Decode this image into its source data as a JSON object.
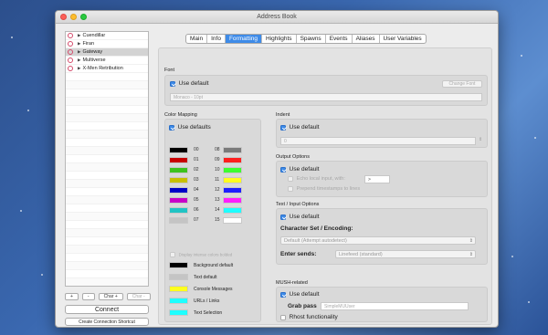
{
  "window": {
    "title": "Address Book"
  },
  "worlds": [
    {
      "name": "Cuendillar",
      "selected": false
    },
    {
      "name": "Firan",
      "selected": false
    },
    {
      "name": "Gateway",
      "selected": true
    },
    {
      "name": "Multiverse",
      "selected": false
    },
    {
      "name": "X-Men Retribution",
      "selected": false
    }
  ],
  "sidebar_buttons": {
    "add": "+",
    "remove": "-",
    "char_add": "Char +",
    "char_remove": "Char -"
  },
  "connect_label": "Connect",
  "shortcut_label": "Create Connection Shortcut",
  "tabs": [
    "Main",
    "Info",
    "Formatting",
    "Highlights",
    "Spawns",
    "Events",
    "Aliases",
    "User Variables"
  ],
  "active_tab": "Formatting",
  "font": {
    "section": "Font",
    "use_default": "Use default",
    "change_font": "Change Font",
    "value": "Monaco - 10pt"
  },
  "color_mapping": {
    "section": "Color Mapping",
    "use_defaults": "Use defaults",
    "left": [
      {
        "num": "00",
        "color": "#000000"
      },
      {
        "num": "01",
        "color": "#c80000"
      },
      {
        "num": "02",
        "color": "#3cc21e"
      },
      {
        "num": "03",
        "color": "#c8c000"
      },
      {
        "num": "04",
        "color": "#0000c8"
      },
      {
        "num": "05",
        "color": "#c800c8"
      },
      {
        "num": "06",
        "color": "#20c4c4"
      },
      {
        "num": "07",
        "color": "#c4c4c4"
      }
    ],
    "right": [
      {
        "num": "08",
        "color": "#7a7a7a"
      },
      {
        "num": "09",
        "color": "#ff1e1e"
      },
      {
        "num": "10",
        "color": "#3cff30"
      },
      {
        "num": "11",
        "color": "#ffff1e"
      },
      {
        "num": "12",
        "color": "#1e1eff"
      },
      {
        "num": "13",
        "color": "#ff1eff"
      },
      {
        "num": "14",
        "color": "#1effff"
      },
      {
        "num": "15",
        "color": "#ffffff"
      }
    ],
    "intense_label": "Display intense colors bolded",
    "specials": [
      {
        "label": "Background default",
        "color": "#000000"
      },
      {
        "label": "Text default",
        "color": "#c4c4c4"
      },
      {
        "label": "Console Messages",
        "color": "#ffff1e"
      },
      {
        "label": "URLs / Links",
        "color": "#1effff"
      },
      {
        "label": "Text Selection",
        "color": "#1effff"
      }
    ]
  },
  "indent": {
    "section": "Indent",
    "use_default": "Use default",
    "value": "0"
  },
  "output_options": {
    "section": "Output Options",
    "use_default": "Use default",
    "echo_label": "Echo local input, with:",
    "echo_value": ">",
    "prepend_label": "Prepend timestamps to lines"
  },
  "text_input": {
    "section": "Text / Input Options",
    "use_default": "Use default",
    "charset_label": "Character Set / Encoding:",
    "charset_value": "Default (Attempt autodetect)",
    "enter_label": "Enter sends:",
    "enter_value": "Linefeed (standard)"
  },
  "mush": {
    "section": "MUSH-related",
    "use_default": "Use default",
    "grab_label": "Grab pass",
    "grab_placeholder": "SimpleMUUser",
    "rhost_label": "Rhost functionality"
  },
  "colors": {
    "accent": "#3e8be8",
    "close": "#fc5f57",
    "minimize": "#fdbd2e",
    "maximize": "#29c941"
  }
}
